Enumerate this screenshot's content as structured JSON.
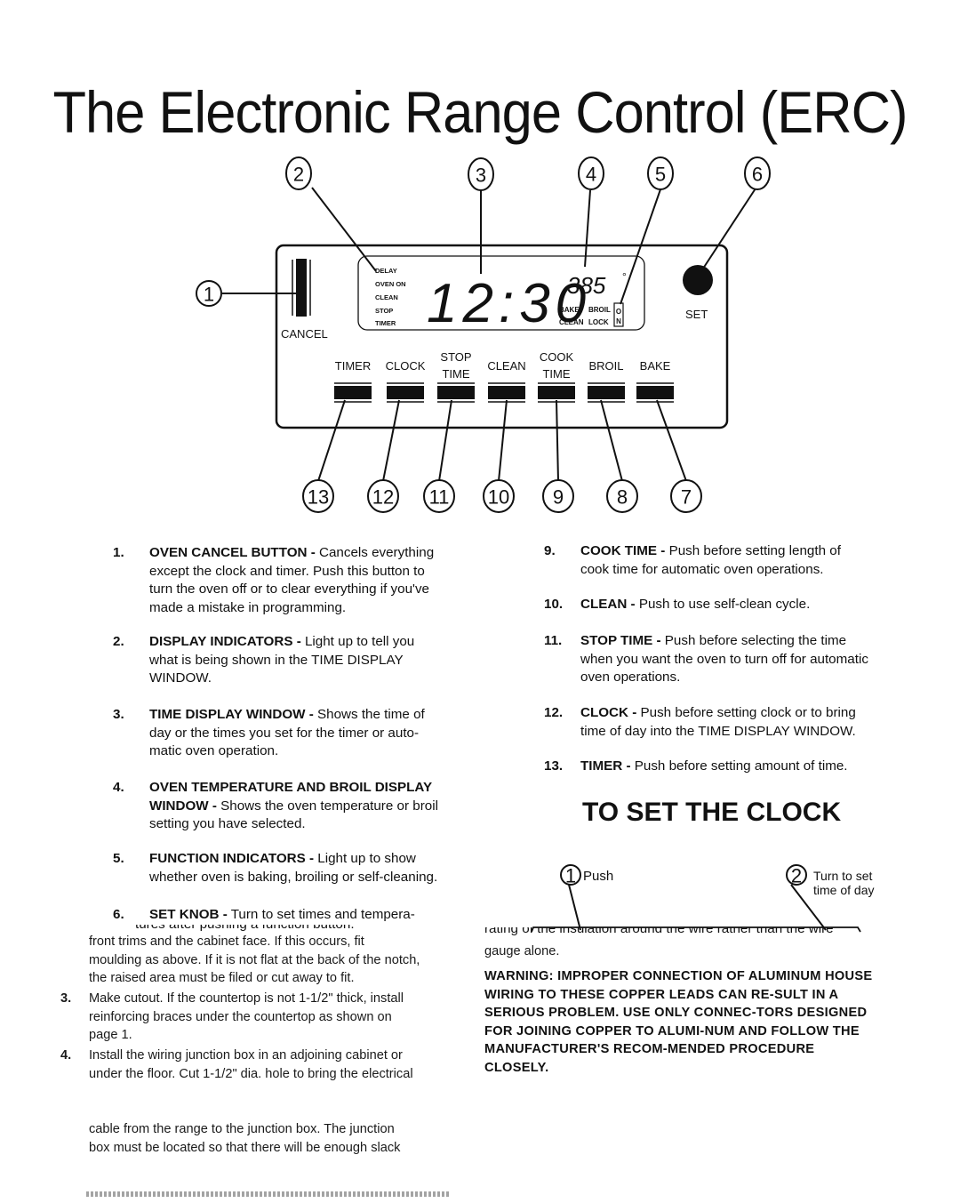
{
  "title": "The Electronic Range Control (ERC)",
  "panel": {
    "cancel_label": "CANCEL",
    "set_label": "SET",
    "indicators": [
      "DELAY",
      "OVEN ON",
      "CLEAN",
      "STOP",
      "TIMER"
    ],
    "time_display": "12:30",
    "temp_display": "385",
    "degree_symbol": "°",
    "function_indicators": [
      "BAKE",
      "BROIL",
      "CLEAN",
      "LOCK"
    ],
    "lock_on": "ON",
    "buttons": [
      {
        "line1": "",
        "line2": "TIMER"
      },
      {
        "line1": "",
        "line2": "CLOCK"
      },
      {
        "line1": "STOP",
        "line2": "TIME"
      },
      {
        "line1": "",
        "line2": "CLEAN"
      },
      {
        "line1": "COOK",
        "line2": "TIME"
      },
      {
        "line1": "",
        "line2": "BROIL"
      },
      {
        "line1": "",
        "line2": "BAKE"
      }
    ]
  },
  "callouts_top": [
    "1",
    "2",
    "3",
    "4",
    "5",
    "6"
  ],
  "callouts_bottom": [
    "13",
    "12",
    "11",
    "10",
    "9",
    "8",
    "7"
  ],
  "items_left": [
    {
      "num": "1.",
      "head": "OVEN CANCEL BUTTON -",
      "lines": [
        " Cancels everything",
        "except the clock and timer.  Push this button to",
        "turn the oven off or to clear everything if you've",
        "made a mistake in programming."
      ]
    },
    {
      "num": "2.",
      "head": "DISPLAY INDICATORS -",
      "lines": [
        " Light up to tell you",
        "what is being shown in the TIME DISPLAY",
        "WINDOW."
      ]
    },
    {
      "num": "3.",
      "head": "TIME DISPLAY WINDOW -",
      "lines": [
        " Shows the time of",
        "day or the times you set for the timer or auto-",
        "matic oven operation."
      ]
    },
    {
      "num": "4.",
      "head": "OVEN TEMPERATURE AND BROIL DISPLAY",
      "lines": [
        "",
        "WINDOW - Shows the oven temperature or broil",
        "setting you have selected."
      ]
    },
    {
      "num": "5.",
      "head": "FUNCTION INDICATORS -",
      "lines": [
        " Light up to show",
        "whether oven is baking, broiling or self-cleaning."
      ]
    },
    {
      "num": "6.",
      "head": "SET KNOB -",
      "lines": [
        " Turn to set times and tempera-",
        "tures after pushing a function button."
      ]
    }
  ],
  "items_right": [
    {
      "num": "9.",
      "head": "COOK TIME -",
      "lines": [
        " Push before setting length of",
        "cook time for automatic oven operations."
      ]
    },
    {
      "num": "10.",
      "head": "CLEAN -",
      "lines": [
        " Push to use self-clean cycle."
      ]
    },
    {
      "num": "11.",
      "head": "STOP TIME -",
      "lines": [
        " Push before selecting the time",
        "when you want the oven to turn off for automatic",
        "oven operations."
      ]
    },
    {
      "num": "12.",
      "head": "CLOCK -",
      "lines": [
        " Push before setting clock or to bring",
        "time of day into  the TIME DISPLAY WINDOW."
      ]
    },
    {
      "num": "13.",
      "head": "TIMER -",
      "lines": [
        " Push before setting amount of time."
      ]
    }
  ],
  "set_clock": {
    "heading": "TO SET THE CLOCK",
    "step1_num": "1",
    "step1_label": "Push",
    "step2_num": "2",
    "step2_line1": "Turn to set",
    "step2_line2": "time of day"
  },
  "overlay_left": {
    "lines": [
      "front trims and the cabinet face.  If this occurs, fit",
      "moulding as above. If it is not flat at the back of the notch,",
      "the raised area must be filed or cut away to fit."
    ],
    "step3_num": "3.",
    "step3_lines": [
      "Make cutout.  If the countertop is not 1-1/2\" thick, install",
      "reinforcing braces under the countertop as shown on",
      "page 1."
    ],
    "step4_num": "4.",
    "step4_lines": [
      "Install the wiring junction box in an adjoining cabinet or",
      "under the floor.  Cut 1-1/2\" dia. hole to bring the electrical"
    ],
    "cont_lines": [
      "cable from the range to the junction box.   The junction",
      "box must be located so that there will be enough slack"
    ]
  },
  "overlay_right": {
    "partial_line": "rating of the insulation around the wire rather than the wire",
    "gauge_line": "gauge alone.",
    "warning": "WARNING:  IMPROPER CONNECTION OF ALUMINUM HOUSE WIRING TO THESE COPPER LEADS CAN RE-SULT IN A SERIOUS PROBLEM.  USE ONLY CONNEC-TORS DESIGNED FOR JOINING COPPER TO ALUMI-NUM AND FOLLOW THE MANUFACTURER'S RECOM-MENDED PROCEDURE CLOSELY."
  }
}
